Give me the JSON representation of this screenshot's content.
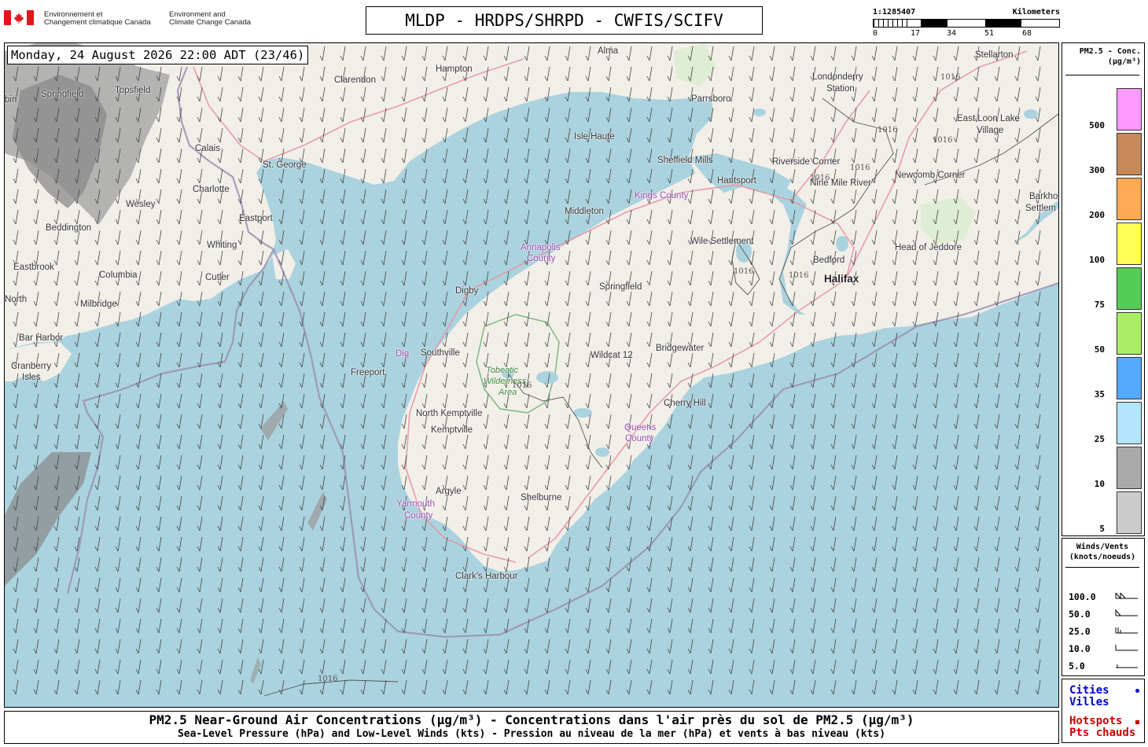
{
  "header": {
    "agency_fr_1": "Environnement et",
    "agency_fr_2": "Changement climatique Canada",
    "agency_en_1": "Environment and",
    "agency_en_2": "Climate Change Canada",
    "title": "MLDP - HRDPS/SHRPD - CWFIS/SCIFV",
    "scale_ratio": "1:1285407",
    "scale_unit": "Kilometers",
    "scale_labels": [
      "0",
      "17",
      "34",
      "51",
      "68"
    ]
  },
  "map": {
    "datetime": "Monday, 24 August 2026 22:00 ADT (23/46)",
    "places": [
      "Alma",
      "Stellarton",
      "Hampton",
      "Clarendon",
      "Londonderry",
      "Station",
      "Springfield",
      "Topsfield",
      "Parrsboro",
      "Isle Haute",
      "East Loon Lake",
      "Village",
      "Calais",
      "St. George",
      "Sheffield Mills",
      "Riverside Corner",
      "Newcomb Corner",
      "Charlotte",
      "Hantsport",
      "Nine Mile River",
      "Barkho",
      "Settlem",
      "Wesley",
      "Eastport",
      "Middleton",
      "Beddington",
      "Whiting",
      "Wile Settlement",
      "Head of Jeddore",
      "Eastbrook",
      "Cutler",
      "Columbia",
      "Bedford",
      "Halifax",
      "Digby",
      "Springfield",
      "Milbridge",
      "North",
      "Bar Harbor",
      "Southville",
      "Wildcat 12",
      "Bridgewater",
      "Cranberry",
      "Isles",
      "Freeport",
      "North Kemptville",
      "Cherry Hill",
      "Kemptville",
      "Argyle",
      "Shelburne",
      "Clark's Harbour",
      "bin"
    ],
    "counties": [
      "Kings County",
      "Annapolis",
      "County",
      "Queens",
      "County",
      "Yarmouth",
      "County",
      "Dig"
    ],
    "parks": [
      "Tobeatic",
      "Wilderness",
      "Area"
    ],
    "isobar_value": "1016"
  },
  "pm_legend": {
    "title_1": "PM2.5 - Conc.",
    "title_2": "(µg/m³)",
    "classes": [
      {
        "label": "500",
        "color": "#ff99ff"
      },
      {
        "label": "300",
        "color": "#c8895a"
      },
      {
        "label": "200",
        "color": "#ffaa55"
      },
      {
        "label": "100",
        "color": "#ffff55"
      },
      {
        "label": "75",
        "color": "#55cc55"
      },
      {
        "label": "50",
        "color": "#aaee66"
      },
      {
        "label": "35",
        "color": "#55aaff"
      },
      {
        "label": "25",
        "color": "#b3e5fc"
      },
      {
        "label": "10",
        "color": "#aaaaaa"
      },
      {
        "label": "5",
        "color": "#cccccc"
      }
    ]
  },
  "wind_legend": {
    "title_1": "Winds/Vents",
    "title_2": "(knots/noeuds)",
    "speeds": [
      "100.0",
      "50.0",
      "25.0",
      "10.0",
      "5.0"
    ]
  },
  "symbols": {
    "cities_1": "Cities",
    "cities_2": "Villes",
    "hotspots_1": "Hotspots",
    "hotspots_2": "Pts chauds",
    "cities_color": "#0000cc",
    "hotspots_color": "#cc0000"
  },
  "footer": {
    "line1": "PM2.5 Near-Ground Air Concentrations (µg/m³) - Concentrations dans l'air près du sol de PM2.5 (µg/m³)",
    "line2": "Sea-Level Pressure (hPa) and Low-Level Winds (kts) - Pression au niveau de la mer (hPa) et vents à bas niveau (kts)"
  }
}
